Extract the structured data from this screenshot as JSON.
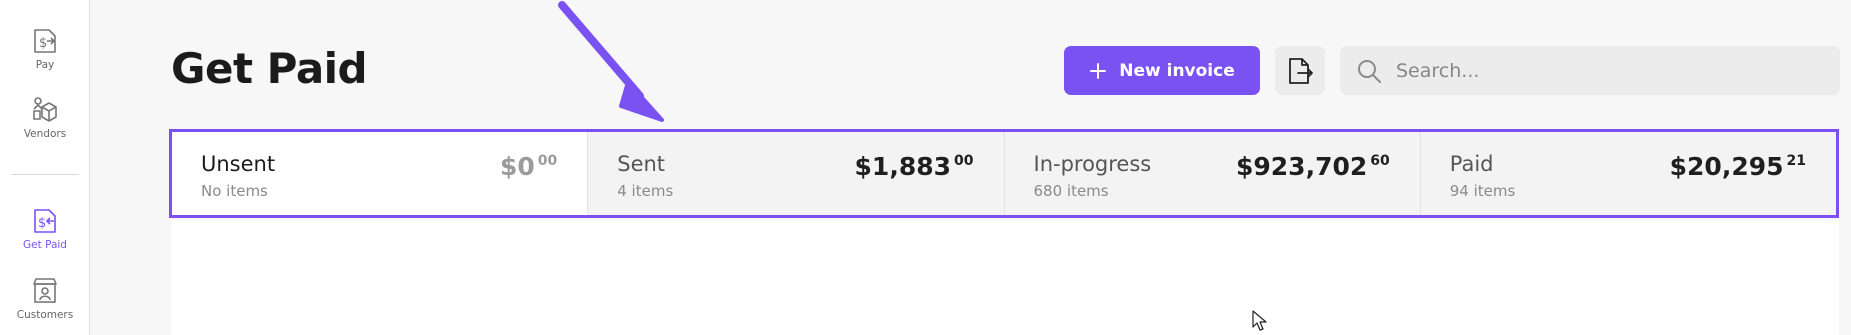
{
  "sidebar": {
    "items": [
      {
        "label": "Pay",
        "icon": "pay-icon",
        "active": false
      },
      {
        "label": "Vendors",
        "icon": "vendors-icon",
        "active": false
      },
      {
        "label": "Get Paid",
        "icon": "get-paid-icon",
        "active": true
      },
      {
        "label": "Customers",
        "icon": "customers-icon",
        "active": false
      }
    ]
  },
  "header": {
    "title": "Get Paid",
    "new_invoice_label": "New invoice",
    "export_icon": "export-file-icon",
    "search_placeholder": "Search..."
  },
  "tabs": [
    {
      "name": "Unsent",
      "count": "No items",
      "amount": "$0",
      "cents": "00",
      "active": true
    },
    {
      "name": "Sent",
      "count": "4 items",
      "amount": "$1,883",
      "cents": "00",
      "active": false
    },
    {
      "name": "In-progress",
      "count": "680 items",
      "amount": "$923,702",
      "cents": "60",
      "active": false
    },
    {
      "name": "Paid",
      "count": "94 items",
      "amount": "$20,295",
      "cents": "21",
      "active": false
    }
  ],
  "colors": {
    "accent": "#7b52f2",
    "highlight_border": "#7b4ff0"
  }
}
